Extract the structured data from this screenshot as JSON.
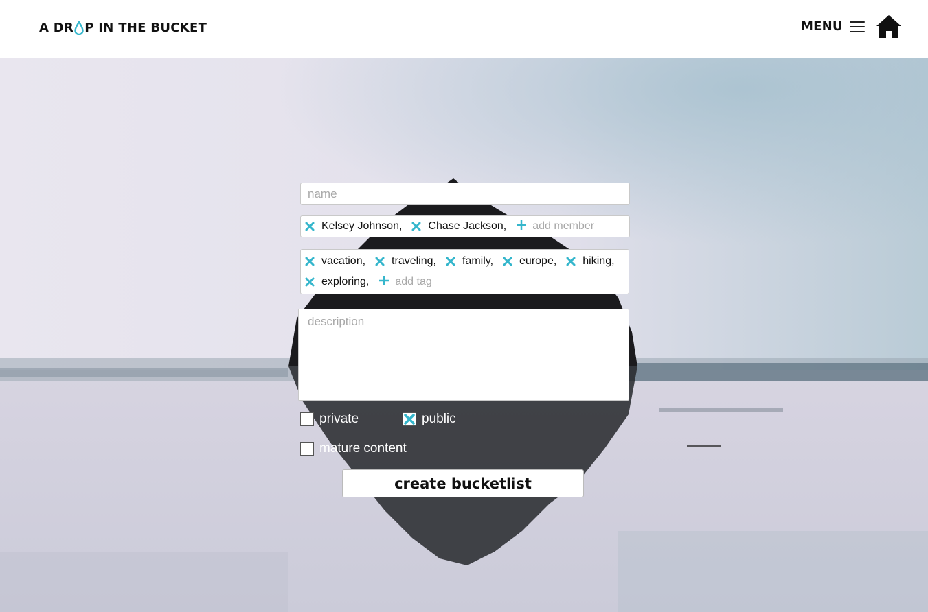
{
  "header": {
    "logo_before": "A DR",
    "logo_after": "P IN THE BUCKET",
    "menu_label": "MENU"
  },
  "form": {
    "name_placeholder": "name",
    "members": [
      "Kelsey Johnson,",
      "Chase Jackson,"
    ],
    "add_member_placeholder": "add member",
    "tags": [
      "vacation,",
      "traveling,",
      "family,",
      "europe,",
      "hiking,",
      "exploring,"
    ],
    "add_tag_placeholder": "add tag",
    "description_placeholder": "description",
    "visibility": {
      "private_label": "private",
      "public_label": "public",
      "selected": "public"
    },
    "mature_label": "mature content",
    "mature_checked": false,
    "submit_label": "create bucketlist"
  },
  "colors": {
    "accent": "#35b6cc",
    "header_bg": "#ffffff",
    "text": "#111111"
  },
  "icons": {
    "remove": "close-x-icon",
    "add": "plus-icon",
    "home": "home-icon",
    "menu": "hamburger-icon",
    "logo_drop": "water-drop-icon"
  }
}
